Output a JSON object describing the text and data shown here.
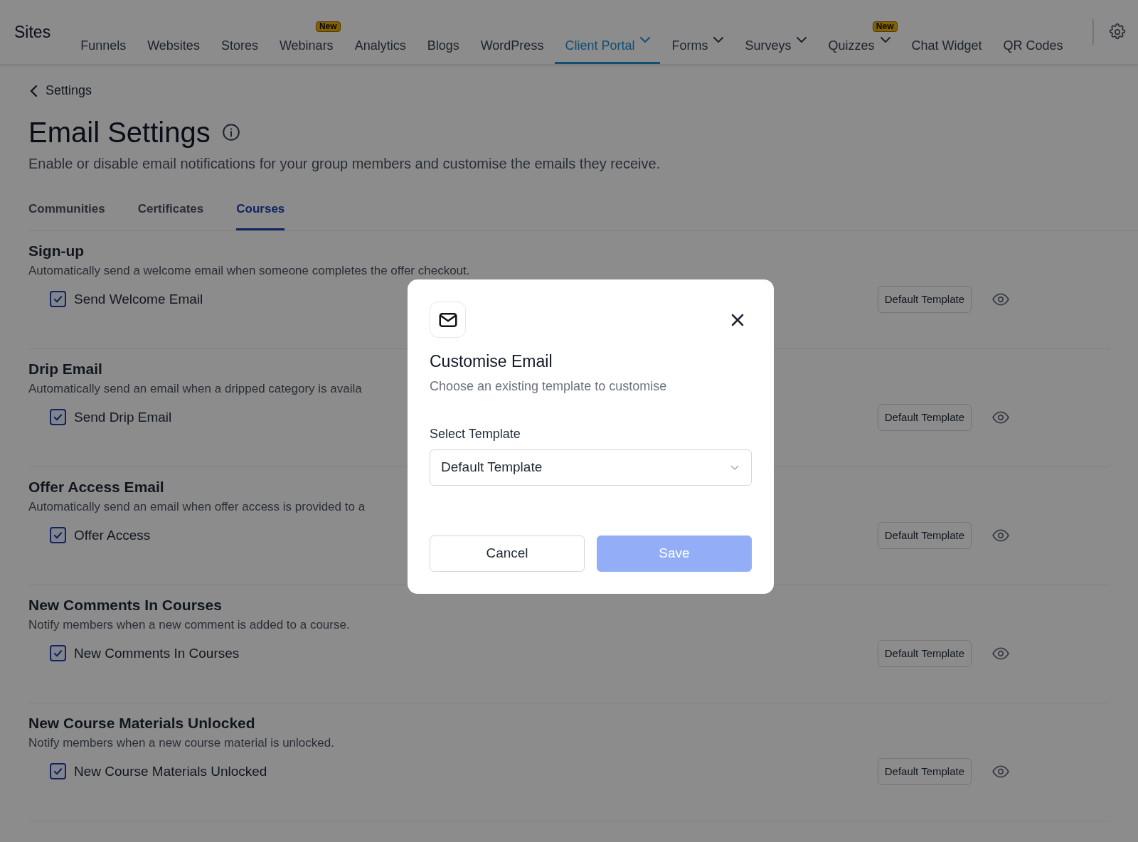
{
  "nav": {
    "brand": "Sites",
    "items": [
      {
        "label": "Funnels",
        "selected": false,
        "dropdown": false
      },
      {
        "label": "Websites",
        "selected": false,
        "dropdown": false
      },
      {
        "label": "Stores",
        "selected": false,
        "dropdown": false
      },
      {
        "label": "Webinars",
        "selected": false,
        "dropdown": false,
        "badge": "New"
      },
      {
        "label": "Analytics",
        "selected": false,
        "dropdown": false
      },
      {
        "label": "Blogs",
        "selected": false,
        "dropdown": false
      },
      {
        "label": "WordPress",
        "selected": false,
        "dropdown": false
      },
      {
        "label": "Client Portal",
        "selected": true,
        "dropdown": true
      },
      {
        "label": "Forms",
        "selected": false,
        "dropdown": true
      },
      {
        "label": "Surveys",
        "selected": false,
        "dropdown": true
      },
      {
        "label": "Quizzes",
        "selected": false,
        "dropdown": true,
        "badge": "New"
      },
      {
        "label": "Chat Widget",
        "selected": false,
        "dropdown": false
      },
      {
        "label": "QR Codes",
        "selected": false,
        "dropdown": false
      }
    ]
  },
  "back_link": "Settings",
  "page": {
    "title": "Email Settings",
    "description": "Enable or disable email notifications for your group members and customise the emails they receive."
  },
  "tabs": [
    {
      "label": "Communities",
      "selected": false
    },
    {
      "label": "Certificates",
      "selected": false
    },
    {
      "label": "Courses",
      "selected": true
    }
  ],
  "sections": [
    {
      "title": "Sign-up",
      "description": "Automatically send a welcome email when someone completes the offer checkout.",
      "option": {
        "label": "Send Welcome Email",
        "checked": true
      },
      "template_button": "Default Template"
    },
    {
      "title": "Drip Email",
      "description": "Automatically send an email when a dripped category is availa",
      "option": {
        "label": "Send Drip Email",
        "checked": true
      },
      "template_button": "Default Template"
    },
    {
      "title": "Offer Access Email",
      "description": "Automatically send an email when offer access is provided to a",
      "option": {
        "label": "Offer Access",
        "checked": true
      },
      "template_button": "Default Template"
    },
    {
      "title": "New Comments In Courses",
      "description": "Notify members when a new comment is added to a course.",
      "option": {
        "label": "New Comments In Courses",
        "checked": true
      },
      "template_button": "Default Template"
    },
    {
      "title": "New Course Materials Unlocked",
      "description": "Notify members when a new course material is unlocked.",
      "option": {
        "label": "New Course Materials Unlocked",
        "checked": true
      },
      "template_button": "Default Template"
    }
  ],
  "dialog": {
    "title": "Customise Email",
    "subtitle": "Choose an existing template to customise",
    "field_label": "Select Template",
    "field_value": "Default Template",
    "buttons": [
      {
        "label": "Cancel",
        "kind": "secondary"
      },
      {
        "label": "Save",
        "kind": "primary",
        "disabled": true
      }
    ]
  }
}
